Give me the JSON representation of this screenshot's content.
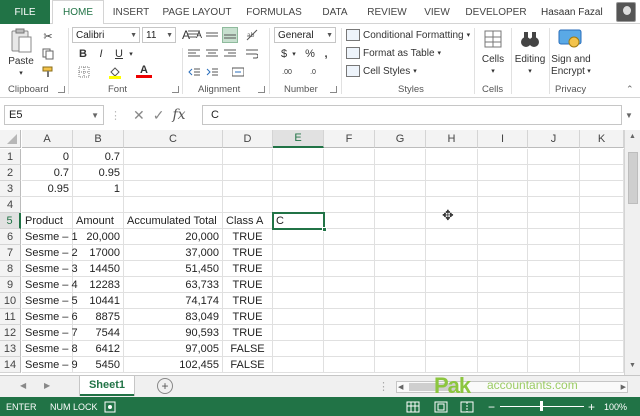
{
  "tabs": {
    "file": "FILE",
    "items": [
      "HOME",
      "INSERT",
      "PAGE LAYOUT",
      "FORMULAS",
      "DATA",
      "REVIEW",
      "VIEW",
      "DEVELOPER"
    ],
    "active": "HOME",
    "user": "Hasaan Fazal"
  },
  "ribbon": {
    "groups": [
      "Clipboard",
      "Font",
      "Alignment",
      "Number",
      "Styles",
      "Cells",
      "Editing",
      "Privacy"
    ],
    "paste": "Paste",
    "font_name": "Calibri",
    "font_size": "11",
    "number_format": "General",
    "conditional_formatting": "Conditional Formatting",
    "format_as_table": "Format as Table",
    "cell_styles": "Cell Styles",
    "cells": "Cells",
    "editing": "Editing",
    "sign_line1": "Sign and",
    "sign_line2": "Encrypt",
    "bold": "B",
    "italic": "I",
    "underline": "U",
    "grow_font": "A",
    "shrink_font": "A",
    "currency": "$",
    "percent": "%",
    "comma": ",",
    "font_color": "A",
    "increase_decimal": ".00",
    "decrease_decimal": ".0"
  },
  "formula_bar": {
    "name_box": "E5",
    "cancel": "✕",
    "enter": "✓",
    "fx": "fx",
    "content": "C"
  },
  "columns": [
    "A",
    "B",
    "C",
    "D",
    "E",
    "F",
    "G",
    "H",
    "I",
    "J",
    "K"
  ],
  "rows": [
    "1",
    "2",
    "3",
    "4",
    "5",
    "6",
    "7",
    "8",
    "9",
    "10",
    "11",
    "12",
    "13",
    "14"
  ],
  "cells": {
    "A1": "0",
    "B1": "0.7",
    "A2": "0.7",
    "B2": "0.95",
    "A3": "0.95",
    "B3": "1",
    "A5": "Product",
    "B5": "Amount",
    "C5": "Accumulated Total",
    "D5": "Class A",
    "E5": "C",
    "A6": "Sesme – 1",
    "B6": "20,000",
    "C6": "20,000",
    "D6": "TRUE",
    "A7": "Sesme – 2",
    "B7": "17000",
    "C7": "37,000",
    "D7": "TRUE",
    "A8": "Sesme – 3",
    "B8": "14450",
    "C8": "51,450",
    "D8": "TRUE",
    "A9": "Sesme – 4",
    "B9": "12283",
    "C9": "63,733",
    "D9": "TRUE",
    "A10": "Sesme – 5",
    "B10": "10441",
    "C10": "74,174",
    "D10": "TRUE",
    "A11": "Sesme – 6",
    "B11": "8875",
    "C11": "83,049",
    "D11": "TRUE",
    "A12": "Sesme – 7",
    "B12": "7544",
    "C12": "90,593",
    "D12": "TRUE",
    "A13": "Sesme – 8",
    "B13": "6412",
    "C13": "97,005",
    "D13": "FALSE",
    "A14": "Sesme – 9",
    "B14": "5450",
    "C14": "102,455",
    "D14": "FALSE"
  },
  "active_cell": "E5",
  "sheets": [
    "Sheet1"
  ],
  "watermark": {
    "brand": "Pak",
    "rest": "accountants.com"
  },
  "status": {
    "mode": "ENTER",
    "numlock": "NUM LOCK",
    "zoom": "100%",
    "minus": "−",
    "plus": "+"
  },
  "colors": {
    "accent": "#217346",
    "selected_header": "#e1e1e1"
  }
}
